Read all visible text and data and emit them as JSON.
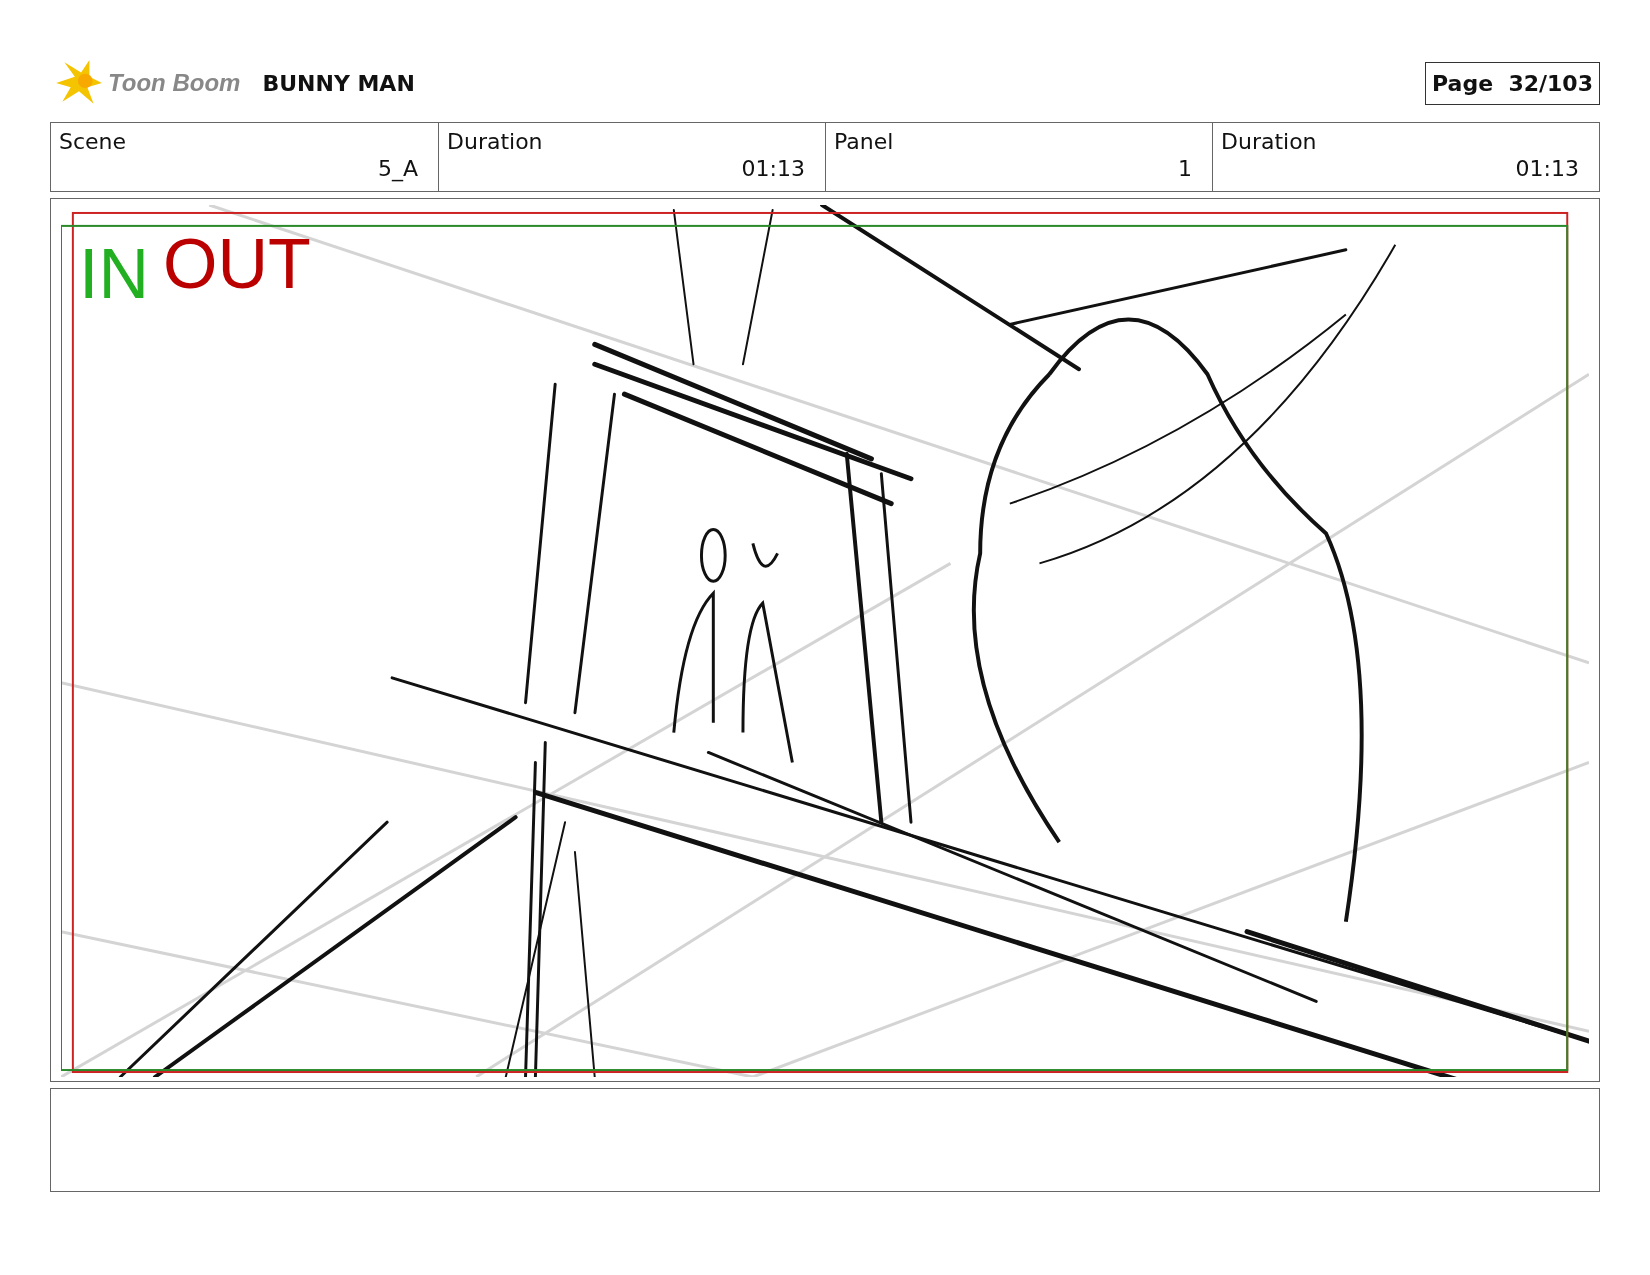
{
  "header": {
    "logo_text": "Toon Boom",
    "title": "BUNNY MAN",
    "page": "Page  32/103"
  },
  "fields": [
    {
      "label": "Scene",
      "value": "5_A"
    },
    {
      "label": "Duration",
      "value": "01:13"
    },
    {
      "label": "Panel",
      "value": "1"
    },
    {
      "label": "Duration",
      "value": "01:13"
    }
  ],
  "panel": {
    "in_label": "IN",
    "out_label": "OUT"
  }
}
